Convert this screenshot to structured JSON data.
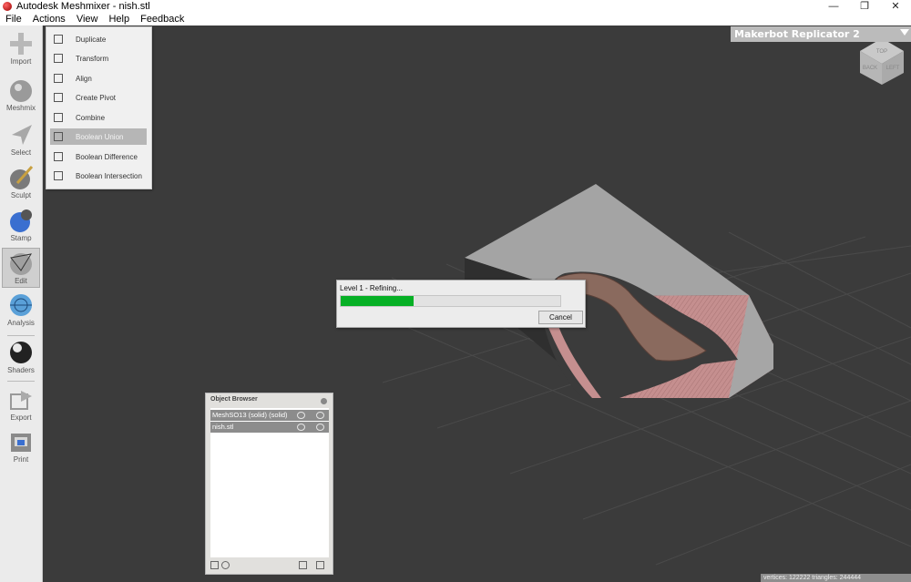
{
  "window": {
    "title": "Autodesk Meshmixer - nish.stl",
    "minimize_glyph": "—",
    "restore_glyph": "❐",
    "close_glyph": "✕"
  },
  "menubar": [
    "File",
    "Actions",
    "View",
    "Help",
    "Feedback"
  ],
  "toolbar": {
    "tools": [
      {
        "label": "Import",
        "icon": "plus-icon"
      },
      {
        "label": "Meshmix",
        "icon": "meshmix-bunny-icon"
      },
      {
        "label": "Select",
        "icon": "select-arrow-icon"
      },
      {
        "label": "Sculpt",
        "icon": "sculpt-brush-icon"
      },
      {
        "label": "Stamp",
        "icon": "stamp-icon"
      },
      {
        "label": "Edit",
        "icon": "edit-sphere-icon",
        "active": true
      },
      {
        "label": "Analysis",
        "icon": "analysis-mesh-icon"
      },
      {
        "label": "Shaders",
        "icon": "shaders-sphere-icon"
      },
      {
        "label": "Export",
        "icon": "export-icon"
      },
      {
        "label": "Print",
        "icon": "print-icon"
      }
    ]
  },
  "edit_menu": {
    "items": [
      {
        "label": "Duplicate",
        "icon": "duplicate-icon"
      },
      {
        "label": "Transform",
        "icon": "transform-icon"
      },
      {
        "label": "Align",
        "icon": "align-icon"
      },
      {
        "label": "Create Pivot",
        "icon": "pivot-icon"
      },
      {
        "label": "Combine",
        "icon": "combine-icon"
      },
      {
        "label": "Boolean Union",
        "icon": "boolean-union-icon",
        "highlighted": true
      },
      {
        "label": "Boolean Difference",
        "icon": "boolean-difference-icon"
      },
      {
        "label": "Boolean Intersection",
        "icon": "boolean-intersection-icon"
      }
    ]
  },
  "printer": {
    "name": "Makerbot Replicator 2"
  },
  "viewcube": {
    "faces": [
      "TOP",
      "BACK",
      "LEFT"
    ]
  },
  "progress_dialog": {
    "message": "Level 1 - Refining...",
    "progress_fraction": 0.33,
    "cancel_label": "Cancel",
    "fill_color": "#06b025"
  },
  "object_browser": {
    "title": "Object Browser",
    "items": [
      {
        "name": "MeshSO13 (solid) (solid)"
      },
      {
        "name": "nish.stl"
      }
    ]
  },
  "status_bar": {
    "text": "vertices: 122222  triangles: 244444"
  },
  "colors": {
    "viewport_bg": "#3b3b3b",
    "mesh_gray": "#9e9e9e",
    "mesh_pink": "#c58f8f",
    "mesh_brown": "#6a4a3e"
  }
}
